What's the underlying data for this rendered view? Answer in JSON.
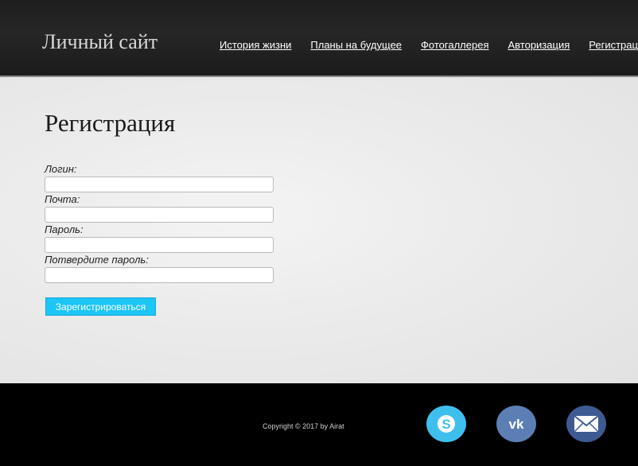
{
  "header": {
    "site_title": "Личный сайт",
    "nav": [
      {
        "label": "История жизни"
      },
      {
        "label": "Планы на будущее"
      },
      {
        "label": "Фотогаллерея"
      },
      {
        "label": "Авторизация"
      },
      {
        "label": "Регистрация"
      }
    ]
  },
  "main": {
    "heading": "Регистрация",
    "form": {
      "fields": [
        {
          "label": "Логин:",
          "value": ""
        },
        {
          "label": "Почта:",
          "value": ""
        },
        {
          "label": "Пароль:",
          "value": ""
        },
        {
          "label": "Потвердите пароль:",
          "value": ""
        }
      ],
      "submit_label": "Зарегистрироваться"
    }
  },
  "footer": {
    "copyright": "Copyright © 2017 by Airat",
    "social": [
      {
        "icon": "skype-icon",
        "color": "#3fbfee"
      },
      {
        "icon": "vk-icon",
        "color": "#5b7fb4"
      },
      {
        "icon": "mail-icon",
        "color": "#3e5a92"
      }
    ]
  },
  "colors": {
    "accent_button": "#1cc6f6",
    "header_bg": "#1e1e1e",
    "footer_bg": "#000000"
  }
}
